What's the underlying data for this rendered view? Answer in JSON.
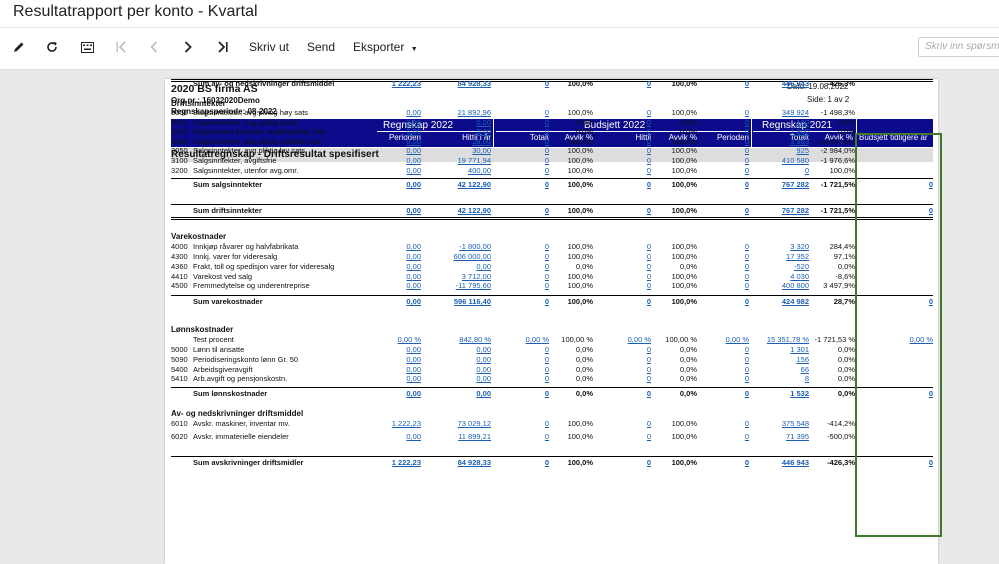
{
  "window": {
    "title": "Resultatrapport per konto - Kvartal"
  },
  "toolbar": {
    "icons": [
      "edit-icon",
      "refresh-icon",
      "keyboard-icon",
      "first-page-icon",
      "previous-page-icon",
      "next-page-icon",
      "last-page-icon"
    ],
    "print_label": "Skriv ut",
    "send_label": "Send",
    "export_label": "Eksporter",
    "search_placeholder": "Skriv inn spørsmål"
  },
  "report": {
    "company": "2020 BS firma AS",
    "org_nr": "Org.nr.: 16032020Demo",
    "period": "Regnskapsperiode: 08-2022",
    "date": "Dato: 19.08.2022",
    "page": "Side: 1 av 2",
    "section_title": "Resultatregnskap - Driftsresultat spesifisert",
    "headers": {
      "group1": "Regnskap 2022",
      "group2": "Budsjett 2022",
      "group3": "Regnskap 2021",
      "col_perioden": "Perioden",
      "col_hittil": "Hittil i år",
      "col_totalt": "Totalt",
      "col_avvik_pct": "Avvik %",
      "col_hittil2": "Hittil",
      "col_avvik_pct2": "Avvik %",
      "col_perioden2": "Perioden",
      "col_totalt2": "Totalt",
      "col_avvik_pct3": "Avvik %",
      "col_budsjett_tidligere": "Budsjett tidligere år"
    }
  },
  "rows": [
    {
      "type": "group",
      "text": "Driftsinntekter"
    },
    {
      "type": "line",
      "acct": "3000",
      "name": "Salgsinntekter, avg.pliktig høy sats",
      "p": "0,00",
      "h": "21 892,96",
      "t": "0",
      "a1": "100,0%",
      "bh": "0",
      "a2": "100,0%",
      "bp": "0",
      "t21": "349 924",
      "a3": "-1 498,3%",
      "bt": ""
    },
    {
      "type": "line",
      "acct": "3010",
      "name": "Salgsinntekter, avg.pliktig Kiosk",
      "p": "0,00",
      "h": "0,00",
      "t": "0",
      "a1": "0,0%",
      "bh": "0",
      "a2": "0,0%",
      "bp": "0",
      "t21": "100",
      "a3": "0,0%",
      "bt": ""
    },
    {
      "type": "line",
      "acct": "3020",
      "name": "Salgsinntekt tjenester, avgiftspliktig, høy",
      "p": "0,00",
      "h": "0,00",
      "t": "0",
      "a1": "0,0%",
      "bh": "0",
      "a2": "0,0%",
      "bp": "0",
      "t21": "1 800",
      "a3": "0,0%",
      "bt": ""
    },
    {
      "type": "line",
      "acct": "3030",
      "name": "Salgsinntekter, avg.pliktig middels sats",
      "p": "0,00",
      "h": "28,00",
      "t": "0",
      "a1": "100,0%",
      "bh": "0",
      "a2": "100,0%",
      "bp": "0",
      "t21": "3 953",
      "a3": "-14 017,9%",
      "bt": ""
    },
    {
      "type": "line",
      "acct": "3050",
      "name": "Salgsinntekter, avg.pliktig lav sats",
      "p": "0,00",
      "h": "30,00",
      "t": "0",
      "a1": "100,0%",
      "bh": "0",
      "a2": "100,0%",
      "bp": "0",
      "t21": "925",
      "a3": "-2 984,0%",
      "bt": ""
    },
    {
      "type": "line",
      "acct": "3100",
      "name": "Salgsinntekter, avgiftsfrie",
      "p": "0,00",
      "h": "19 771,94",
      "t": "0",
      "a1": "100,0%",
      "bh": "0",
      "a2": "100,0%",
      "bp": "0",
      "t21": "410 580",
      "a3": "-1 976,6%",
      "bt": ""
    },
    {
      "type": "line",
      "acct": "3200",
      "name": "Salgsinntekter, utenfor avg.omr.",
      "p": "0,00",
      "h": "400,00",
      "t": "0",
      "a1": "100,0%",
      "bh": "0",
      "a2": "100,0%",
      "bp": "0",
      "t21": "0",
      "a3": "100,0%",
      "bt": ""
    },
    {
      "type": "sum",
      "name": "Sum salgsinntekter",
      "p": "0,00",
      "h": "42 122,90",
      "t": "0",
      "a1": "100,0%",
      "bh": "0",
      "a2": "100,0%",
      "bp": "0",
      "t21": "767 282",
      "a3": "-1 721,5%",
      "bt": "0"
    },
    {
      "type": "sum",
      "name": "Sum driftsinntekter",
      "p": "0,00",
      "h": "42 122,90",
      "t": "0",
      "a1": "100,0%",
      "bh": "0",
      "a2": "100,0%",
      "bp": "0",
      "t21": "767 282",
      "a3": "-1 721,5%",
      "bt": "0"
    },
    {
      "type": "group",
      "text": "Varekostnader"
    },
    {
      "type": "line",
      "acct": "4000",
      "name": "Innkjøp råvarer og halvfabrikata",
      "p": "0,00",
      "h": "-1 800,00",
      "t": "0",
      "a1": "100,0%",
      "bh": "0",
      "a2": "100,0%",
      "bp": "0",
      "t21": "3 320",
      "a3": "284,4%",
      "bt": ""
    },
    {
      "type": "line",
      "acct": "4300",
      "name": "Innkj. varer for videresalg",
      "p": "0,00",
      "h": "606 000,00",
      "t": "0",
      "a1": "100,0%",
      "bh": "0",
      "a2": "100,0%",
      "bp": "0",
      "t21": "17 352",
      "a3": "97,1%",
      "bt": ""
    },
    {
      "type": "line",
      "acct": "4360",
      "name": "Frakt, toll og spedisjon varer for videresalg",
      "p": "0,00",
      "h": "0,00",
      "t": "0",
      "a1": "0,0%",
      "bh": "0",
      "a2": "0,0%",
      "bp": "0",
      "t21": "-520",
      "a3": "0,0%",
      "bt": ""
    },
    {
      "type": "line",
      "acct": "4410",
      "name": "Varekost ved salg",
      "p": "0,00",
      "h": "3 712,00",
      "t": "0",
      "a1": "100,0%",
      "bh": "0",
      "a2": "100,0%",
      "bp": "0",
      "t21": "4 030",
      "a3": "-8,6%",
      "bt": ""
    },
    {
      "type": "line",
      "acct": "4500",
      "name": "Fremmedytelse og underentreprise",
      "p": "0,00",
      "h": "-11 795,60",
      "t": "0",
      "a1": "100,0%",
      "bh": "0",
      "a2": "100,0%",
      "bp": "0",
      "t21": "400 800",
      "a3": "3 497,9%",
      "bt": ""
    },
    {
      "type": "sum",
      "name": "Sum varekostnader",
      "p": "0,00",
      "h": "596 116,40",
      "t": "0",
      "a1": "100,0%",
      "bh": "0",
      "a2": "100,0%",
      "bp": "0",
      "t21": "424 982",
      "a3": "28,7%",
      "bt": "0"
    },
    {
      "type": "group",
      "text": "Lønnskostnader"
    },
    {
      "type": "line",
      "acct": "",
      "name": "Test procent",
      "p": "0,00 %",
      "h": "842,80 %",
      "t": "0,00 %",
      "a1": "100,00 %",
      "bh": "0,00 %",
      "a2": "100,00 %",
      "bp": "0,00 %",
      "t21": "15 351,78 %",
      "a3": "-1 721,53 %",
      "bt": "0,00 %"
    },
    {
      "type": "line",
      "acct": "5000",
      "name": "Lønn til ansatte",
      "p": "0,00",
      "h": "0,00",
      "t": "0",
      "a1": "0,0%",
      "bh": "0",
      "a2": "0,0%",
      "bp": "0",
      "t21": "1 301",
      "a3": "0,0%",
      "bt": ""
    },
    {
      "type": "line",
      "acct": "5090",
      "name": "Periodiseringskonto lønn Gr. 50",
      "p": "0,00",
      "h": "0,00",
      "t": "0",
      "a1": "0,0%",
      "bh": "0",
      "a2": "0,0%",
      "bp": "0",
      "t21": "156",
      "a3": "0,0%",
      "bt": ""
    },
    {
      "type": "line",
      "acct": "5400",
      "name": "Arbeidsgiveravgift",
      "p": "0,00",
      "h": "0,00",
      "t": "0",
      "a1": "0,0%",
      "bh": "0",
      "a2": "0,0%",
      "bp": "0",
      "t21": "66",
      "a3": "0,0%",
      "bt": ""
    },
    {
      "type": "line",
      "acct": "5410",
      "name": "Arb.avgift og pensjonskostn.",
      "p": "0,00",
      "h": "0,00",
      "t": "0",
      "a1": "0,0%",
      "bh": "0",
      "a2": "0,0%",
      "bp": "0",
      "t21": "8",
      "a3": "0,0%",
      "bt": ""
    },
    {
      "type": "sum",
      "name": "Sum lønnskostnader",
      "p": "0,00",
      "h": "0,00",
      "t": "0",
      "a1": "0,0%",
      "bh": "0",
      "a2": "0,0%",
      "bp": "0",
      "t21": "1 532",
      "a3": "0,0%",
      "bt": "0"
    },
    {
      "type": "group",
      "text": "Av- og nedskrivninger driftsmiddel"
    },
    {
      "type": "line",
      "acct": "6010",
      "name": "Avskr. maskiner, inventar mv.",
      "p": "1 222,23",
      "h": "73 029,12",
      "t": "0",
      "a1": "100,0%",
      "bh": "0",
      "a2": "100,0%",
      "bp": "0",
      "t21": "375 548",
      "a3": "-414,2%",
      "bt": ""
    },
    {
      "type": "line",
      "acct": "6020",
      "name": "Avskr. immaterielle eiendeler",
      "p": "0,00",
      "h": "11 899,21",
      "t": "0",
      "a1": "100,0%",
      "bh": "0",
      "a2": "100,0%",
      "bp": "0",
      "t21": "71 395",
      "a3": "-500,0%",
      "bt": ""
    },
    {
      "type": "sum",
      "name": "Sum avskrivninger driftsmidler",
      "p": "1 222,23",
      "h": "84 928,33",
      "t": "0",
      "a1": "100,0%",
      "bh": "0",
      "a2": "100,0%",
      "bp": "0",
      "t21": "446 943",
      "a3": "-426,3%",
      "bt": "0"
    },
    {
      "type": "sum",
      "name": "Sum av- og nedskrivninger driftsmiddel",
      "p": "1 222,23",
      "h": "84 928,33",
      "t": "0",
      "a1": "100,0%",
      "bh": "0",
      "a2": "100,0%",
      "bp": "0",
      "t21": "446 943",
      "a3": "-426,3%",
      "bt": ""
    }
  ]
}
